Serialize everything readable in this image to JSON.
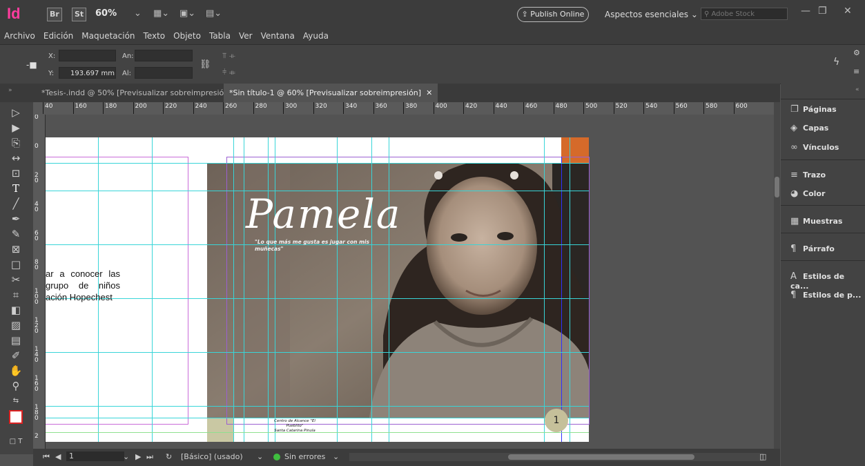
{
  "app": {
    "logo": "Id",
    "bridge": "Br",
    "stock_badge": "St",
    "zoom": "60%",
    "publish_online": "Publish Online",
    "workspace": "Aspectos esenciales",
    "search_placeholder": "Adobe Stock"
  },
  "menu": [
    "Archivo",
    "Edición",
    "Maquetación",
    "Texto",
    "Objeto",
    "Tabla",
    "Ver",
    "Ventana",
    "Ayuda"
  ],
  "control": {
    "x_label": "X:",
    "y_label": "Y:",
    "y_value": "193.697 mm",
    "w_label": "An:",
    "h_label": "Al:"
  },
  "tabs": [
    {
      "label": "*Tesis-.indd @ 50% [Previsualizar sobreimpresión]",
      "active": false
    },
    {
      "label": "*Sin título-1 @ 60% [Previsualizar sobreimpresión]",
      "active": true
    }
  ],
  "ruler_h": [
    "40",
    "160",
    "180",
    "200",
    "220",
    "240",
    "260",
    "280",
    "300",
    "320",
    "340",
    "360",
    "380",
    "400",
    "420",
    "440",
    "460",
    "480",
    "500",
    "520",
    "540",
    "560",
    "580",
    "600"
  ],
  "ruler_v": [
    "0",
    "0",
    "2 0",
    "4 0",
    "6 0",
    "8 0",
    "1 0 0",
    "1 2 0",
    "1 4 0",
    "1 6 0",
    "1 8 0",
    "2"
  ],
  "document": {
    "name": "Pamela",
    "quote": "\"Lo que más me gusta es jugar con mis muñecas\"",
    "body_text": "ar a conocer las grupo de niños ación Hopechest",
    "credit_line1": "Centro de Alcance \"El Pueblito\"",
    "credit_line2": "Santa Catarina Pinula",
    "page_number": "1"
  },
  "panels": [
    {
      "label": "Páginas",
      "icon": "pages-icon"
    },
    {
      "label": "Capas",
      "icon": "layers-icon"
    },
    {
      "label": "Vínculos",
      "icon": "links-icon"
    },
    {
      "label": "Trazo",
      "icon": "stroke-icon"
    },
    {
      "label": "Color",
      "icon": "color-icon"
    },
    {
      "label": "Muestras",
      "icon": "swatches-icon"
    },
    {
      "label": "Párrafo",
      "icon": "paragraph-icon"
    },
    {
      "label": "Estilos de ca...",
      "icon": "character-styles-icon"
    },
    {
      "label": "Estilos de p...",
      "icon": "paragraph-styles-icon"
    }
  ],
  "status": {
    "page": "1",
    "style": "[Básico] (usado)",
    "errors": "Sin errores"
  },
  "colors": {
    "accent_orange": "#d56a2a",
    "guide": "#38d5d8",
    "ok_green": "#3fbf3f"
  }
}
